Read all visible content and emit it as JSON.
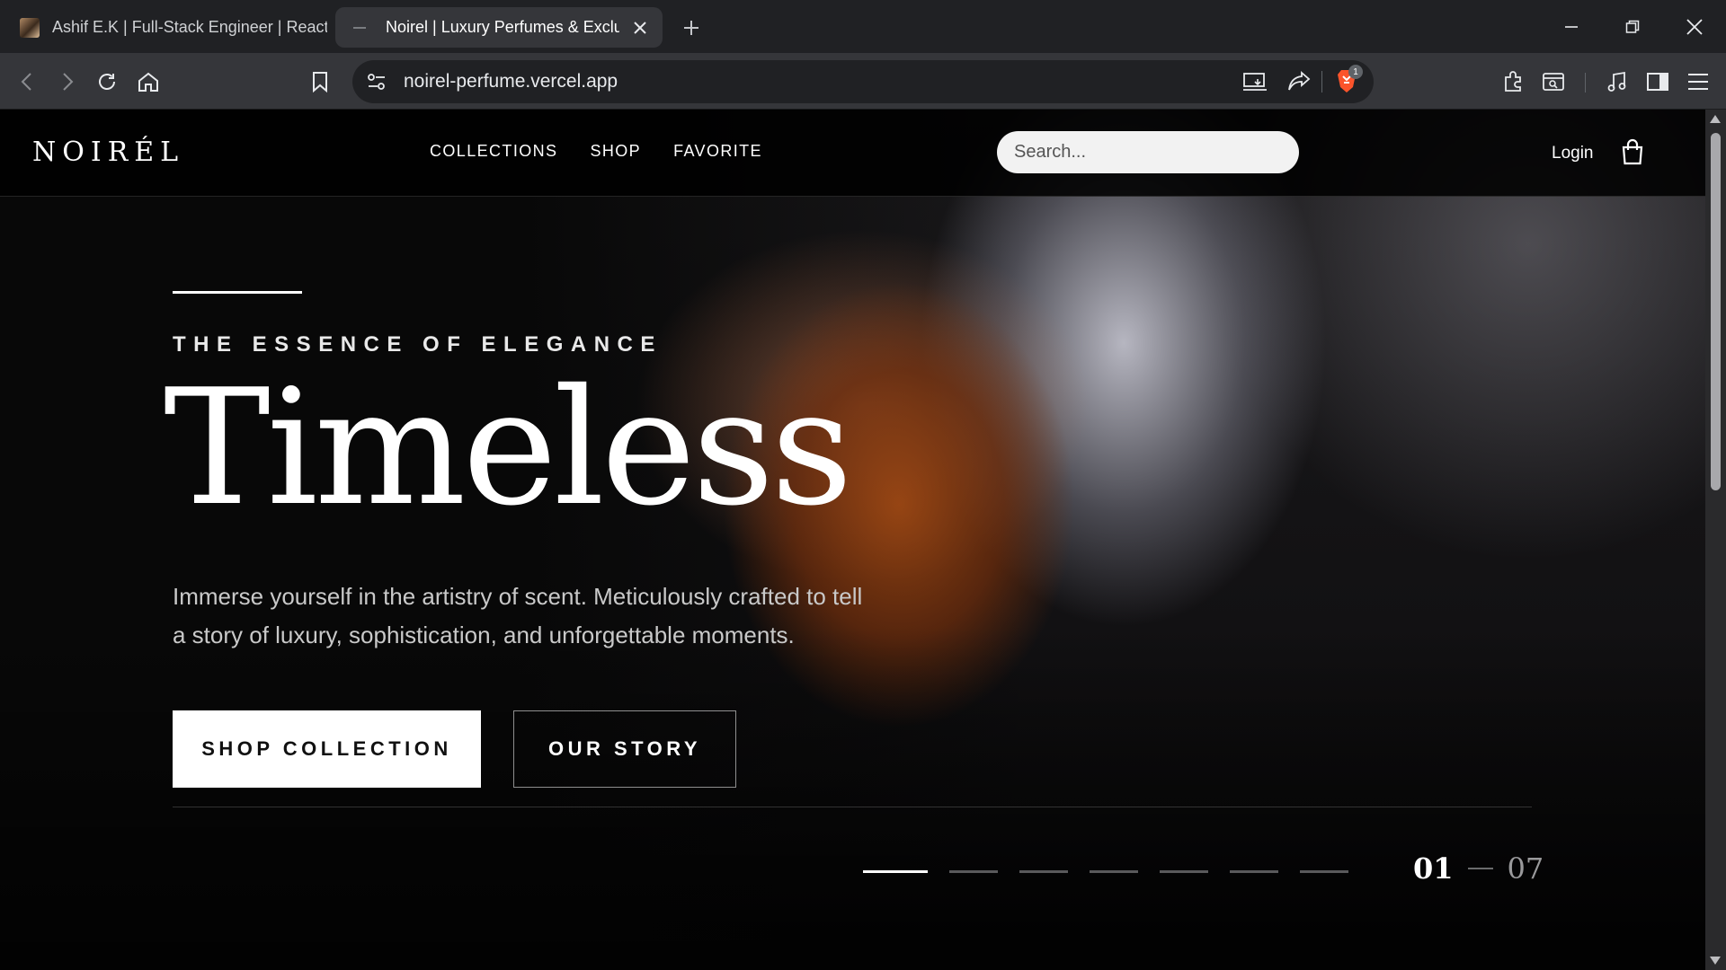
{
  "browser": {
    "tabs": [
      {
        "title": "Ashif E.K | Full-Stack Engineer | React",
        "active": false
      },
      {
        "title": "Noirel | Luxury Perfumes & Exclusive Fragrances",
        "active": true
      }
    ],
    "new_tab_icon": "plus-icon",
    "url": "noirel-perfume.vercel.app",
    "extension_badge": "1"
  },
  "site": {
    "logo": "NOIRÉL",
    "nav": {
      "collections": "COLLECTIONS",
      "shop": "SHOP",
      "favorite": "FAVORITE"
    },
    "search_placeholder": "Search...",
    "login": "Login",
    "cart_icon": "shopping-bag-icon"
  },
  "hero": {
    "eyebrow": "THE ESSENCE OF ELEGANCE",
    "headline": "Timeless",
    "description_line1": "Immerse yourself in the artistry of scent. Meticulously crafted to tell",
    "description_line2": "a story of luxury, sophistication, and unforgettable moments.",
    "primary_button": "SHOP COLLECTION",
    "secondary_button": "OUR STORY",
    "slide_count": 7,
    "active_slide": 1,
    "counter_current": "01",
    "counter_total": "07"
  },
  "colors": {
    "background": "#060606",
    "text": "#ffffff",
    "button_bg": "#ffffff",
    "button_text": "#111111",
    "chrome_dark": "#202124",
    "chrome_toolbar": "#35363a"
  }
}
